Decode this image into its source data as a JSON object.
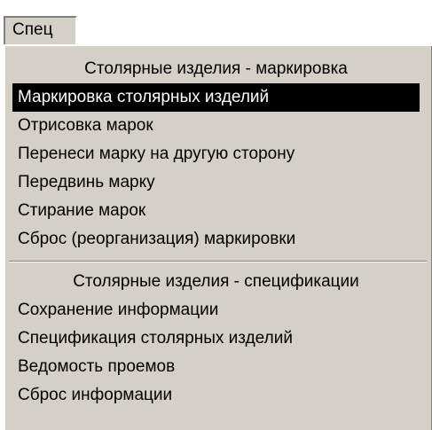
{
  "menubar": {
    "title": "Спец"
  },
  "menu": {
    "section1": {
      "header": "Столярные изделия - маркировка",
      "items": [
        "Маркировка столярных изделий",
        "Отрисовка марок",
        "Перенеси марку на другую сторону",
        "Передвинь марку",
        "Стирание марок",
        "Сброс (реорганизация) маркировки"
      ]
    },
    "section2": {
      "header": "Столярные изделия - спецификации",
      "items": [
        "Сохранение информации",
        "Спецификация столярных изделий",
        "Ведомость проемов",
        "Сброс информации"
      ]
    },
    "selected_item": "Маркировка столярных изделий",
    "colors": {
      "menu_bg": "#d4d0c8",
      "highlight_bg": "#000000",
      "highlight_text": "#ffffff"
    }
  }
}
